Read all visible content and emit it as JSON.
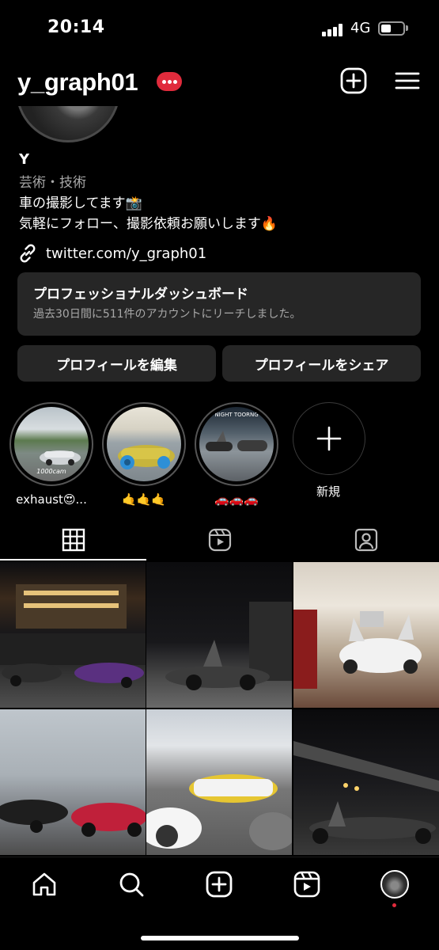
{
  "status_bar": {
    "time": "20:14",
    "network": "4G",
    "battery_level": 0.45,
    "signal_bars": 4
  },
  "header": {
    "username": "y_graph01",
    "has_notification_badge": true,
    "create_icon": "plus-square-icon",
    "menu_icon": "hamburger-icon"
  },
  "profile": {
    "display_name": "Y",
    "category": "芸術・技術",
    "bio_lines": [
      "車の撮影してます📸",
      "気軽にフォロー、撮影依頼お願いします🔥"
    ],
    "link": "twitter.com/y_graph01"
  },
  "dashboard": {
    "title": "プロフェッショナルダッシュボード",
    "subtitle": "過去30日間に511件のアカウントにリーチしました。"
  },
  "buttons": {
    "edit_profile": "プロフィールを編集",
    "share_profile": "プロフィールをシェア"
  },
  "highlights": [
    {
      "label": "exhaust😍...",
      "cover_text": "1000cam"
    },
    {
      "label": "🤙🤙🤙",
      "cover_text": ""
    },
    {
      "label": "🚗🚗🚗",
      "cover_text": "NIGHT TOORNG"
    }
  ],
  "new_highlight_label": "新規",
  "tabs": [
    {
      "name": "posts",
      "icon": "grid-icon",
      "active": true
    },
    {
      "name": "reels",
      "icon": "reels-icon",
      "active": false
    },
    {
      "name": "tagged",
      "icon": "tagged-icon",
      "active": false
    }
  ],
  "bottom_nav": [
    "home-icon",
    "search-icon",
    "create-icon",
    "reels-icon",
    "profile-avatar"
  ],
  "colors": {
    "background": "#000000",
    "surface": "#262626",
    "badge": "#e02b3c",
    "secondary_text": "#a8a8a8"
  }
}
